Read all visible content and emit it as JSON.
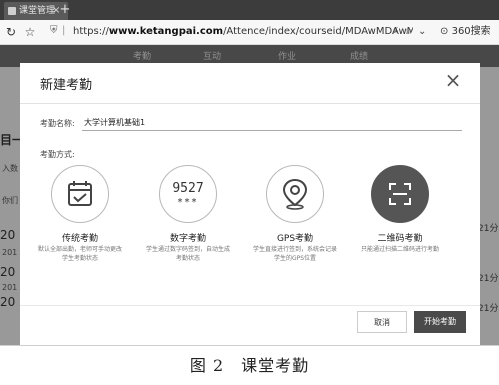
{
  "browser": {
    "tab_title": "课堂管理",
    "tab_close": "×",
    "new_tab": "+",
    "url_prefix": "https://",
    "url_domain": "www.ketangpai.com",
    "url_path": "/Attence/index/courseid/MDAwMDAwMDAwMI",
    "search_engine": "360搜索"
  },
  "background_page": {
    "nav_items": [
      "考勤",
      "互动",
      "作业",
      "成绩"
    ],
    "left_fragments": [
      "目一",
      "入数",
      "你们",
      "20",
      "201",
      "20",
      "201",
      "20"
    ],
    "right_fragments": [
      "21分",
      "21分",
      "21分"
    ]
  },
  "modal": {
    "title": "新建考勤",
    "close_glyph": "×",
    "name_label": "考勤名称:",
    "name_value": "大学计算机基础1",
    "mode_label": "考勤方式:",
    "modes": [
      {
        "name": "传统考勤",
        "desc": "默认全部出勤，老师可手动更改学生考勤状态",
        "icon": "calendar-check-icon"
      },
      {
        "name": "数字考勤",
        "desc": "学生通过数字码签到，自动生成考勤状态",
        "icon": "digit-code-icon",
        "digits": "9527",
        "stars": "***"
      },
      {
        "name": "GPS考勤",
        "desc": "学生直接进行签到，系统会记录学生的GPS位置",
        "icon": "map-pin-icon"
      },
      {
        "name": "二维码考勤",
        "desc": "只能通过扫描二维码进行考勤",
        "icon": "qr-scan-icon",
        "selected": true
      }
    ],
    "cancel_label": "取消",
    "start_label": "开始考勤"
  },
  "caption": "图 2　课堂考勤"
}
